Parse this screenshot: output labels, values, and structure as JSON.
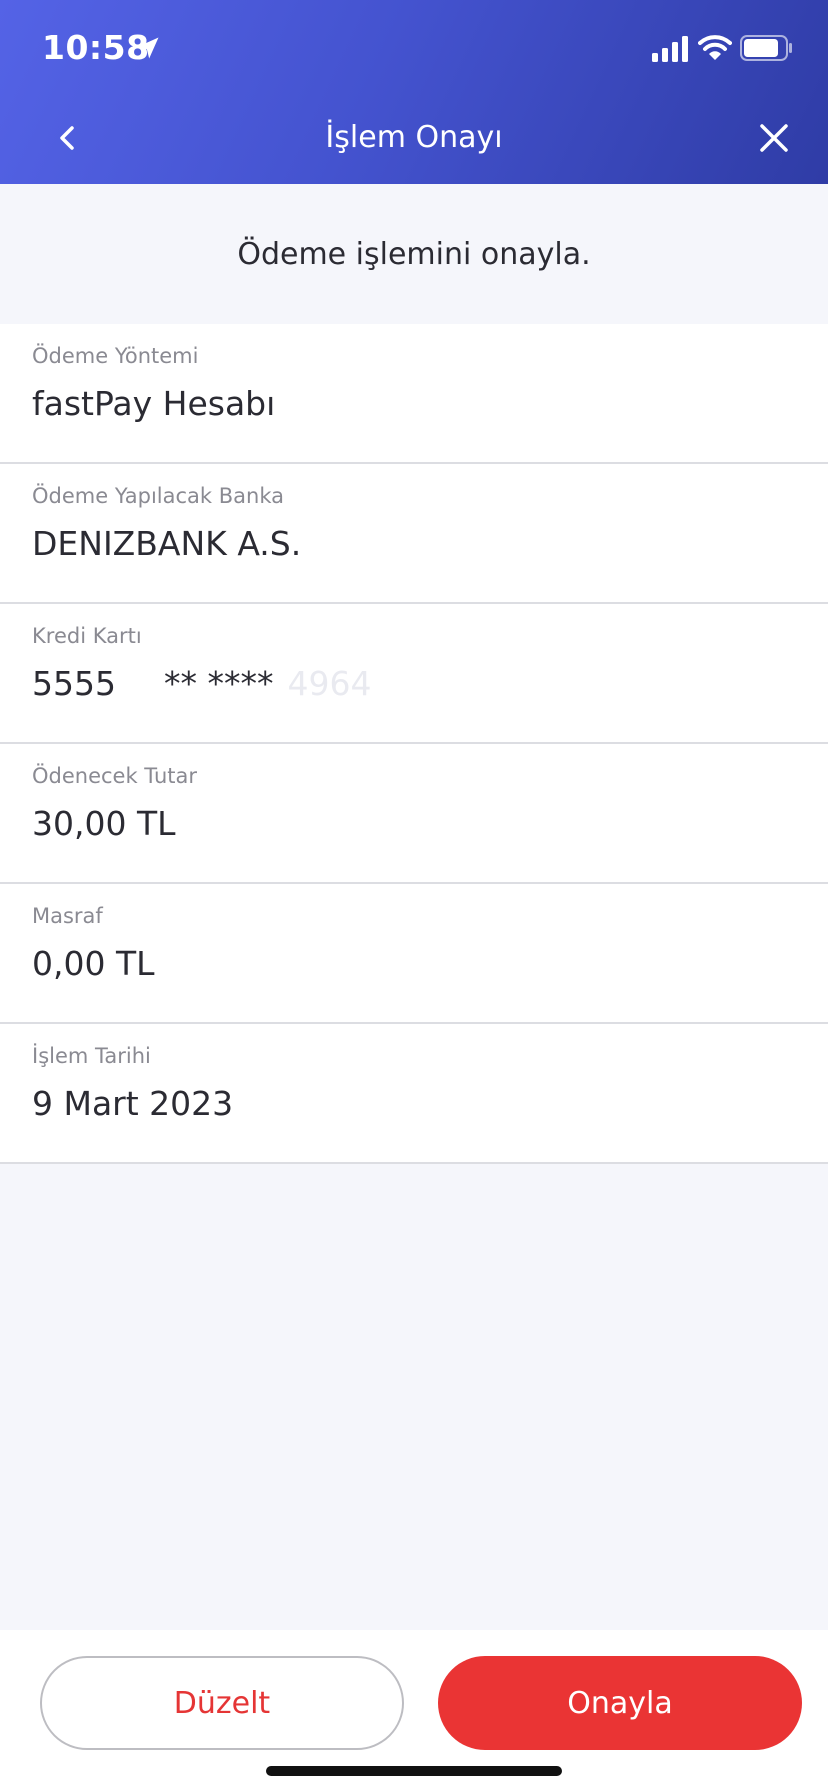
{
  "status_bar": {
    "time": "10:58"
  },
  "nav": {
    "title": "İşlem Onayı"
  },
  "subtitle": "Ödeme işlemini onayla.",
  "details": [
    {
      "label": "Ödeme Yöntemi",
      "value": "fastPay Hesabı"
    },
    {
      "label": "Ödeme Yapılacak Banka",
      "value": "DENIZBANK A.S."
    },
    {
      "label": "Kredi Kartı",
      "card_prefix": "5555",
      "card_mask": "** ****",
      "card_suffix": "4964"
    },
    {
      "label": "Ödenecek Tutar",
      "value": "30,00 TL"
    },
    {
      "label": "Masraf",
      "value": "0,00 TL"
    },
    {
      "label": "İşlem Tarihi",
      "value": "9 Mart 2023"
    }
  ],
  "buttons": {
    "edit": "Düzelt",
    "confirm": "Onayla"
  },
  "colors": {
    "header_start": "#5463e6",
    "header_end": "#2f3ca6",
    "accent_red": "#ea3434"
  }
}
